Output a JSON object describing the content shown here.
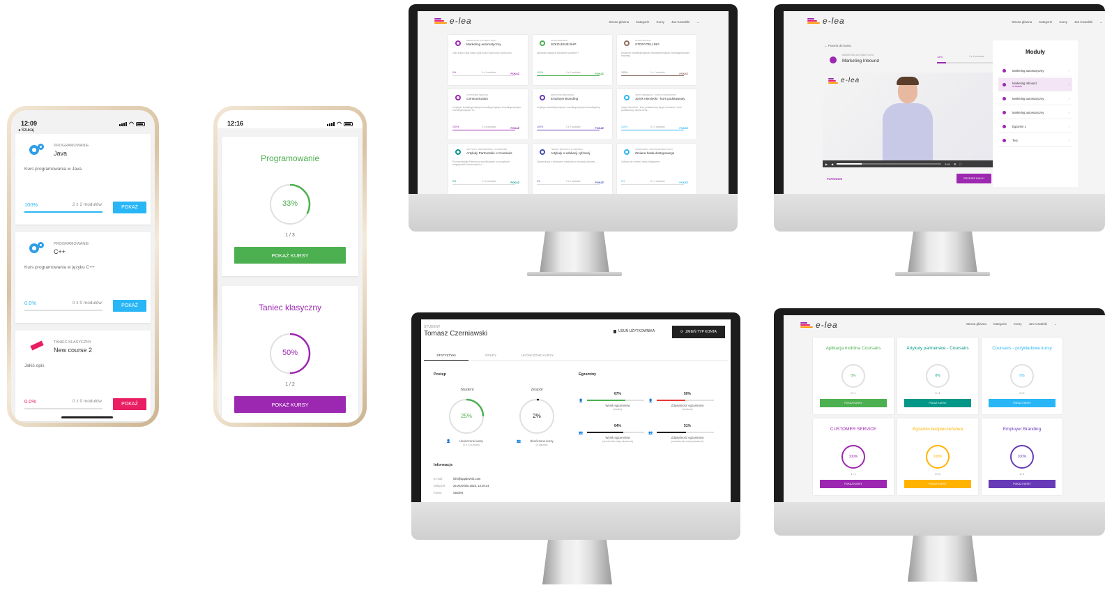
{
  "colors": {
    "blue": "#29b6f6",
    "green": "#4caf50",
    "purple": "#9c27b0",
    "pink": "#e91e63",
    "teal": "#009688",
    "amber": "#ffb300",
    "indigo": "#673ab7",
    "dark": "#212121",
    "red": "#e53935"
  },
  "phone1": {
    "time": "12:09",
    "back": "◂ Szukaj",
    "cards": [
      {
        "category": "PROGRAMOWANIE",
        "name": "Java",
        "desc": "Kurs programowania w Java",
        "pct": "100%",
        "progress": 1.0,
        "modules": "2 z 2 modułów",
        "button": "POKAŻ"
      },
      {
        "category": "PROGRAMOWANIE",
        "name": "C++",
        "desc": "Kurs programowania w języku C++",
        "pct": "0.0%",
        "progress": 0.0,
        "modules": "0 z 0 modułów",
        "button": "POKAŻ"
      },
      {
        "category": "TANIEC KLASYCZNY",
        "name": "New course 2",
        "desc": "Jakiś opis",
        "pct": "0.0%",
        "progress": 0.0,
        "modules": "0 z 0 modułów",
        "button": "POKAŻ"
      }
    ]
  },
  "phone2": {
    "time": "12:16",
    "cards": [
      {
        "title": "Programowanie",
        "pct": "33%",
        "progress": 0.33,
        "fraction": "1 / 3",
        "button": "POKAŻ KURSY"
      },
      {
        "title": "Taniec klasyczny",
        "pct": "50%",
        "progress": 0.5,
        "fraction": "1 / 2",
        "button": "POKAŻ KURSY"
      }
    ]
  },
  "logo": "e-lea",
  "nav": [
    "Strona główna",
    "Kategorie",
    "Kursy",
    "Jan Kowalski",
    "⌄"
  ],
  "mon1": {
    "tiles": [
      {
        "cat": "MARKETING AUTOMATYCZNY",
        "name": "Marketing automatyczny",
        "desc": "Opis kursu Opis kursu Opis kursu Opis kursu Opis kursu",
        "pct": "0%",
        "progress": 0.0,
        "mods": "0 z 1 modułów",
        "btn": "POKAŻ",
        "color": "#9c27b0"
      },
      {
        "cat": "SZKOLENIE BHP",
        "name": "SZKOLENIE BHP",
        "desc": "szkolenie wstępne szkolenie szkolenie +",
        "pct": "100%",
        "progress": 1.0,
        "mods": "0 z 0 modułów",
        "btn": "POKAŻ",
        "color": "#4caf50"
      },
      {
        "cat": "STORYTELLING",
        "name": "STORYTELLING",
        "desc": "employer brandingemployer brandingemployer brandingemployer branding",
        "pct": "100%",
        "progress": 1.0,
        "mods": "0 z 0 modułów",
        "btn": "POKAŻ",
        "color": "#8d6e63"
      },
      {
        "cat": "CUSTOMER SERVICE",
        "name": "communication",
        "desc": "employer brandingemployer brandingemployer brandingemployer brandingemployer br...",
        "pct": "100%",
        "progress": 1.0,
        "mods": "0 z 4 modułów",
        "btn": "POKAŻ",
        "color": "#9c27b0"
      },
      {
        "cat": "EMPLOYER BRANDING",
        "name": "Employer Branding",
        "desc": "employer brandingemployer brandingemployer brandingemp",
        "pct": "100%",
        "progress": 1.0,
        "mods": "0 z 0 modułów",
        "btn": "POKAŻ",
        "color": "#673ab7"
      },
      {
        "cat": "JĘZYK NIEMIECKI - KURS PODSTAWOWY",
        "name": "Język niemiecki - kurs podstawowy",
        "desc": "Język niemiecki - kurs podstawowy Język niemiecki - kurs podstawowy Język niemi...",
        "pct": "100%",
        "progress": 1.0,
        "mods": "0 z 0 modułów",
        "btn": "POKAŻ",
        "color": "#29b6f6"
      },
      {
        "cat": "ARTYKUŁY PARTNERSKIE - COURSAIRS",
        "name": "Artykuły Partnerskie o Coursairs",
        "desc": "Poznaj artykuły Partnerów opublikowane w poczytnych magazynach biznesowych o ...",
        "pct": "0%",
        "progress": 0.0,
        "mods": "0 z 0 modułów",
        "btn": "POKAŻ",
        "color": "#009688"
      },
      {
        "cat": "TRENDY EDUKACJI CYFROWEJ",
        "name": "Artykuły o edukacji cyfrowej",
        "desc": "Zapoznaj się z zestawem artykułów o edukacji cyfrowej ...",
        "pct": "0%",
        "progress": 0.0,
        "mods": "0 z 0 modułów",
        "btn": "POKAŻ",
        "color": "#3f51b5"
      },
      {
        "cat": "COURSAIRS - PRZYKŁADOWE KURSY",
        "name": "Zmiana hasła dostępowego",
        "desc": "Zobacz jak zmienić hasło dostępowe",
        "pct": "0%",
        "progress": 0.0,
        "mods": "0 z 1 modułów",
        "btn": "POKAŻ",
        "color": "#29b6f6"
      }
    ]
  },
  "mon2": {
    "back": "← Powrót do kursu",
    "cat": "MARKETING AUTOMATYCZNY",
    "title": "Marketing Inbound",
    "pct": "16%",
    "progress": 0.16,
    "mods": "1 z 6 modułów",
    "prev": "POPRZEDNI",
    "next": "PRZEJDŹ DALEJ",
    "video_time": "2:01",
    "sidebar_title": "Moduły",
    "items": [
      {
        "label": "Marketing automatyczny",
        "sub": ""
      },
      {
        "label": "Marketing Inbound",
        "sub": "w trakcie"
      },
      {
        "label": "Marketing automatyczny",
        "sub": ""
      },
      {
        "label": "Marketing automatyczny",
        "sub": ""
      },
      {
        "label": "Egzamin 1",
        "sub": ""
      },
      {
        "label": "Test",
        "sub": ""
      }
    ]
  },
  "mon3": {
    "role": "STUDENT",
    "name": "Tomasz Czerniawski",
    "delete": "USUŃ UŻYTKOWNIKA",
    "change": "ZMIEŃ TYP KONTA",
    "tabs": [
      "STATYSTYKI",
      "GRUPY",
      "UKOŃCZONE KURSY"
    ],
    "progress_title": "Postęp",
    "exams_title": "Egzaminy",
    "student": {
      "label": "Student",
      "pct": "25%",
      "progress": 0.25,
      "caption": "Ukończone kursy",
      "sub": "(1 z 4 kursów)"
    },
    "team": {
      "label": "Zespół",
      "pct": "2%",
      "progress": 0.02,
      "caption": "Ukończone kursy",
      "sub": "(z całości)"
    },
    "exams": [
      {
        "pct": "67%",
        "progress": 0.67,
        "caption": "Wynik egzaminów",
        "sub": "(średni)",
        "color": "#4caf50"
      },
      {
        "pct": "50%",
        "progress": 0.5,
        "caption": "Zdawalność egzaminów",
        "sub": "(średnia)",
        "color": "#e53935"
      },
      {
        "pct": "64%",
        "progress": 0.64,
        "caption": "Wynik egzaminów",
        "sub": "(średni dla całej akademii)",
        "color": "#212121"
      },
      {
        "pct": "51%",
        "progress": 0.51,
        "caption": "Zdawalność egzaminów",
        "sub": "(średnia dla całej akademii)",
        "color": "#212121"
      }
    ],
    "info_title": "Informacje",
    "info": [
      {
        "k": "E-mail:",
        "v": "info@appdevelo.com"
      },
      {
        "k": "Dołączył:",
        "v": "25 września 2018, 13:19:14"
      },
      {
        "k": "Konto:",
        "v": "Student"
      }
    ]
  },
  "mon4": {
    "cards": [
      {
        "title": "Aplikacja mobilna Coursairs",
        "pct": "0%",
        "progress": 0.0,
        "fraction": "0 / 1",
        "btn": "POKAŻ KURSY",
        "color": "#4caf50"
      },
      {
        "title": "Artykuły partnerskie - Coursairs",
        "pct": "0%",
        "progress": 0.0,
        "fraction": "0 / 1",
        "btn": "POKAŻ KURSY",
        "color": "#009688"
      },
      {
        "title": "Coursairs - przykładowe kursy",
        "pct": "0%",
        "progress": 0.0,
        "fraction": "0 / 2",
        "btn": "POKAŻ KURSY",
        "color": "#29b6f6"
      },
      {
        "title": "CUSTOMER SERVICE",
        "pct": "100%",
        "progress": 1.0,
        "fraction": "1 / 1",
        "btn": "POKAŻ KURSY",
        "color": "#9c27b0"
      },
      {
        "title": "Egzamin bezpieczeństwa",
        "pct": "100%",
        "progress": 1.0,
        "fraction": "0 / 0",
        "btn": "POKAŻ KURSY",
        "color": "#ffb300"
      },
      {
        "title": "Employer Branding",
        "pct": "100%",
        "progress": 1.0,
        "fraction": "1 / 1",
        "btn": "POKAŻ KURSY",
        "color": "#673ab7"
      }
    ]
  }
}
